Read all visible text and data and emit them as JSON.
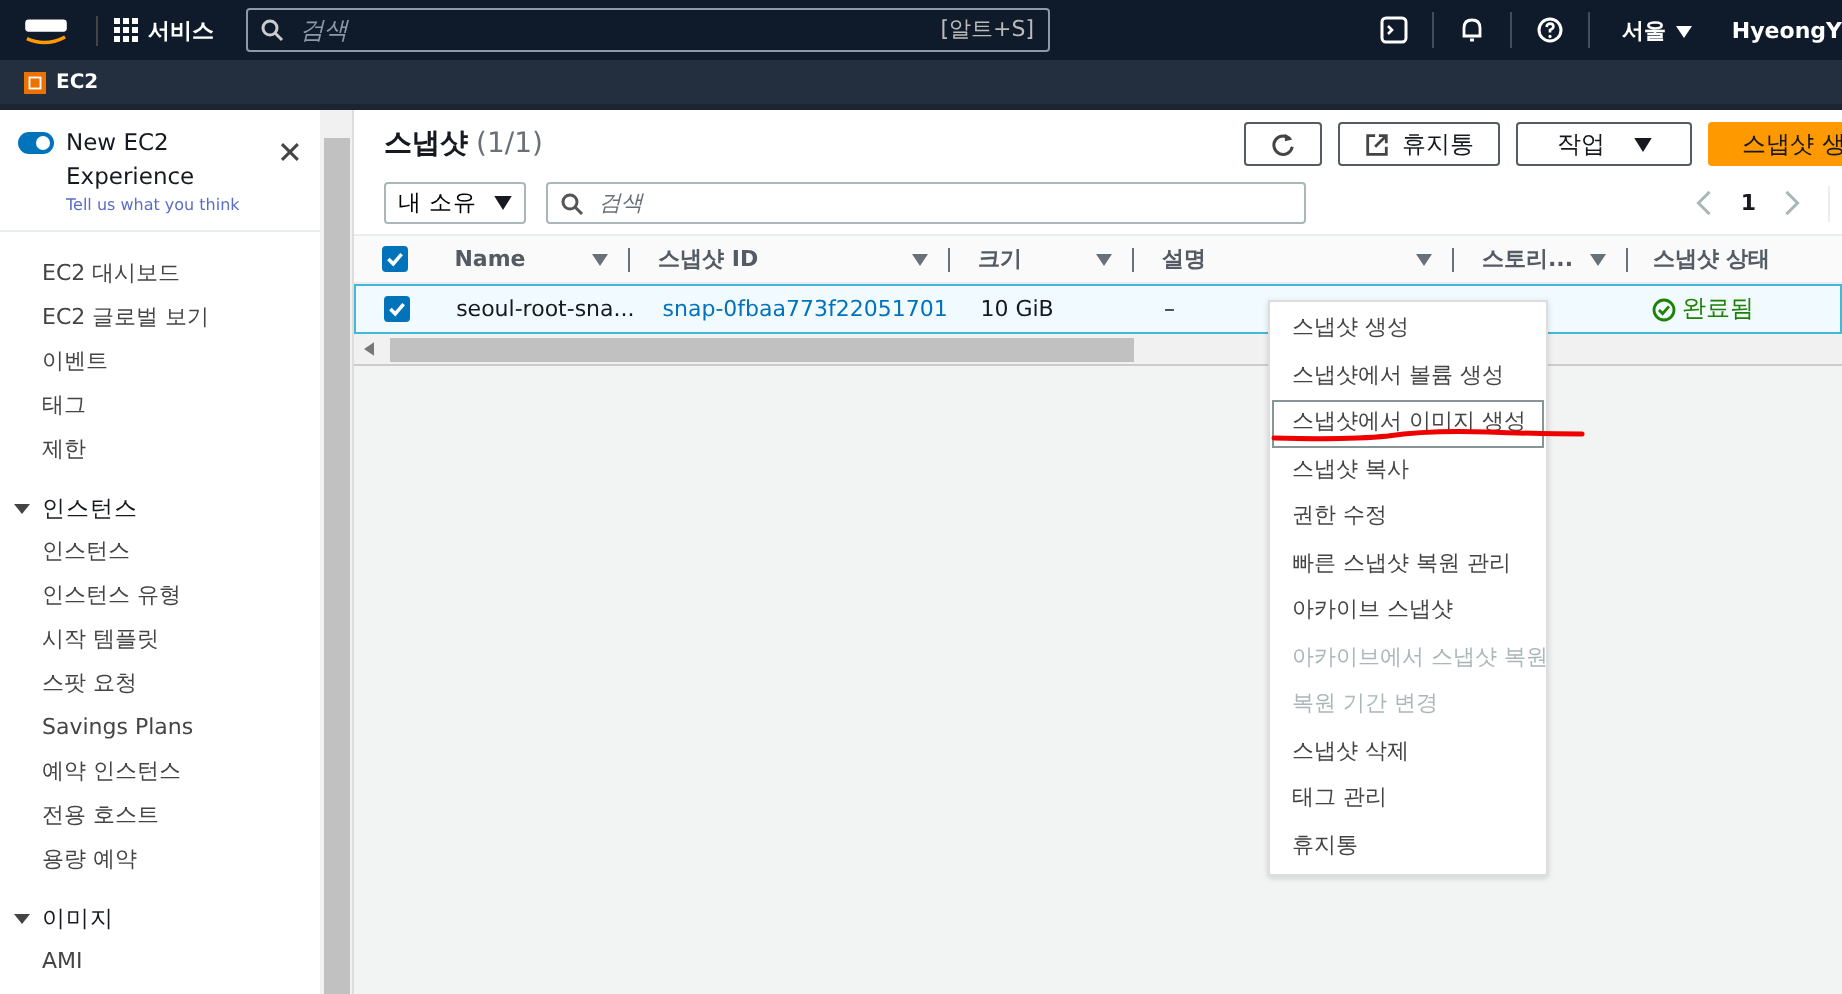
{
  "topbar": {
    "services": "서비스",
    "search_placeholder": "검색",
    "shortcut": "[알트+S]",
    "region": "서울",
    "user": "HyeongY"
  },
  "breadcrumb": "EC2",
  "sidebar": {
    "toggle": {
      "label": "New EC2 Experience",
      "on": true
    },
    "feedback_link": "Tell us what you think",
    "items": [
      "EC2 대시보드",
      "EC2 글로벌 보기",
      "이벤트",
      "태그",
      "제한"
    ],
    "sections": [
      {
        "title": "인스턴스",
        "expanded": true,
        "children": [
          "인스턴스",
          "인스턴스 유형",
          "시작 템플릿",
          "스팟 요청",
          "Savings Plans",
          "예약 인스턴스",
          "전용 호스트",
          "용량 예약"
        ]
      },
      {
        "title": "이미지",
        "expanded": true,
        "children": [
          "AMI"
        ]
      }
    ]
  },
  "panel": {
    "title": "스냅샷",
    "count": "(1/1)",
    "buttons": [
      {
        "kind": "refresh"
      },
      {
        "kind": "external",
        "label": "휴지통"
      },
      {
        "kind": "dropdown",
        "label": "작업"
      },
      {
        "kind": "primary",
        "label": "스냅샷 생"
      }
    ],
    "filter": "내 소유",
    "search_placeholder": "검색",
    "page": "1"
  },
  "table": {
    "all_checked": true,
    "columns": [
      "Name",
      "스냅샷 ID",
      "크기",
      "설명",
      "스토리...",
      "스냅샷 상태"
    ],
    "rows": [
      {
        "selected": true,
        "name": "seoul-root-sna...",
        "id": "snap-0fbaa773f22051701",
        "size": "10 GiB",
        "description": "–",
        "status": "완료됨"
      }
    ]
  },
  "context_menu": [
    {
      "label": "스냅샷 생성",
      "disabled": false,
      "selected": false
    },
    {
      "label": "스냅샷에서 볼륨 생성",
      "disabled": false,
      "selected": false
    },
    {
      "label": "스냅샷에서 이미지 생성",
      "disabled": false,
      "selected": true
    },
    {
      "label": "스냅샷 복사",
      "disabled": false,
      "selected": false
    },
    {
      "label": "권한 수정",
      "disabled": false,
      "selected": false
    },
    {
      "label": "빠른 스냅샷 복원 관리",
      "disabled": false,
      "selected": false
    },
    {
      "label": "아카이브 스냅샷",
      "disabled": false,
      "selected": false
    },
    {
      "label": "아카이브에서 스냅샷 복원",
      "disabled": true,
      "selected": false
    },
    {
      "label": "복원 기간 변경",
      "disabled": true,
      "selected": false
    },
    {
      "label": "스냅샷 삭제",
      "disabled": false,
      "selected": false
    },
    {
      "label": "태그 관리",
      "disabled": false,
      "selected": false
    },
    {
      "label": "휴지통",
      "disabled": false,
      "selected": false
    }
  ]
}
